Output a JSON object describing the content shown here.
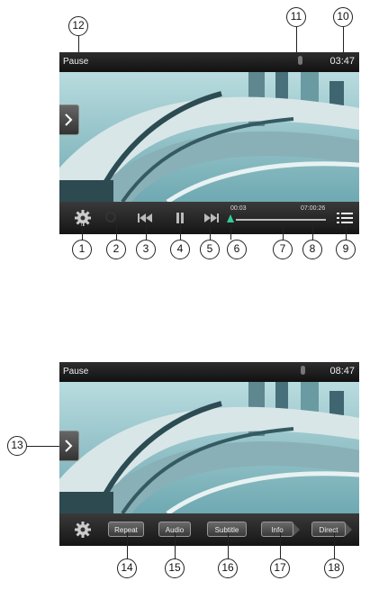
{
  "top_screen": {
    "status_title": "Pause",
    "clock": "03:47",
    "time_elapsed": "00:03",
    "time_total": "07:00:26"
  },
  "bottom_screen": {
    "status_title": "Pause",
    "clock": "08:47",
    "buttons": [
      "Repeat",
      "Audio",
      "Subtitle",
      "Info",
      "Direct"
    ]
  },
  "callouts_top": [
    "12",
    "11",
    "10"
  ],
  "callouts_controls": [
    "1",
    "2",
    "3",
    "4",
    "5",
    "6",
    "7",
    "8",
    "9"
  ],
  "callout_side": "13",
  "callouts_bottom": [
    "14",
    "15",
    "16",
    "17",
    "18"
  ],
  "icons": {
    "settings": "gear-icon",
    "repeat": "circle-icon",
    "previous": "skip-back-icon",
    "pause": "pause-icon",
    "next": "skip-forward-icon",
    "menu": "list-icon",
    "side_tab": "chevron-right-icon",
    "mic": "microphone-icon"
  },
  "colors": {
    "progress_knob": "#33cc99",
    "sky": "#9cc9cf"
  }
}
